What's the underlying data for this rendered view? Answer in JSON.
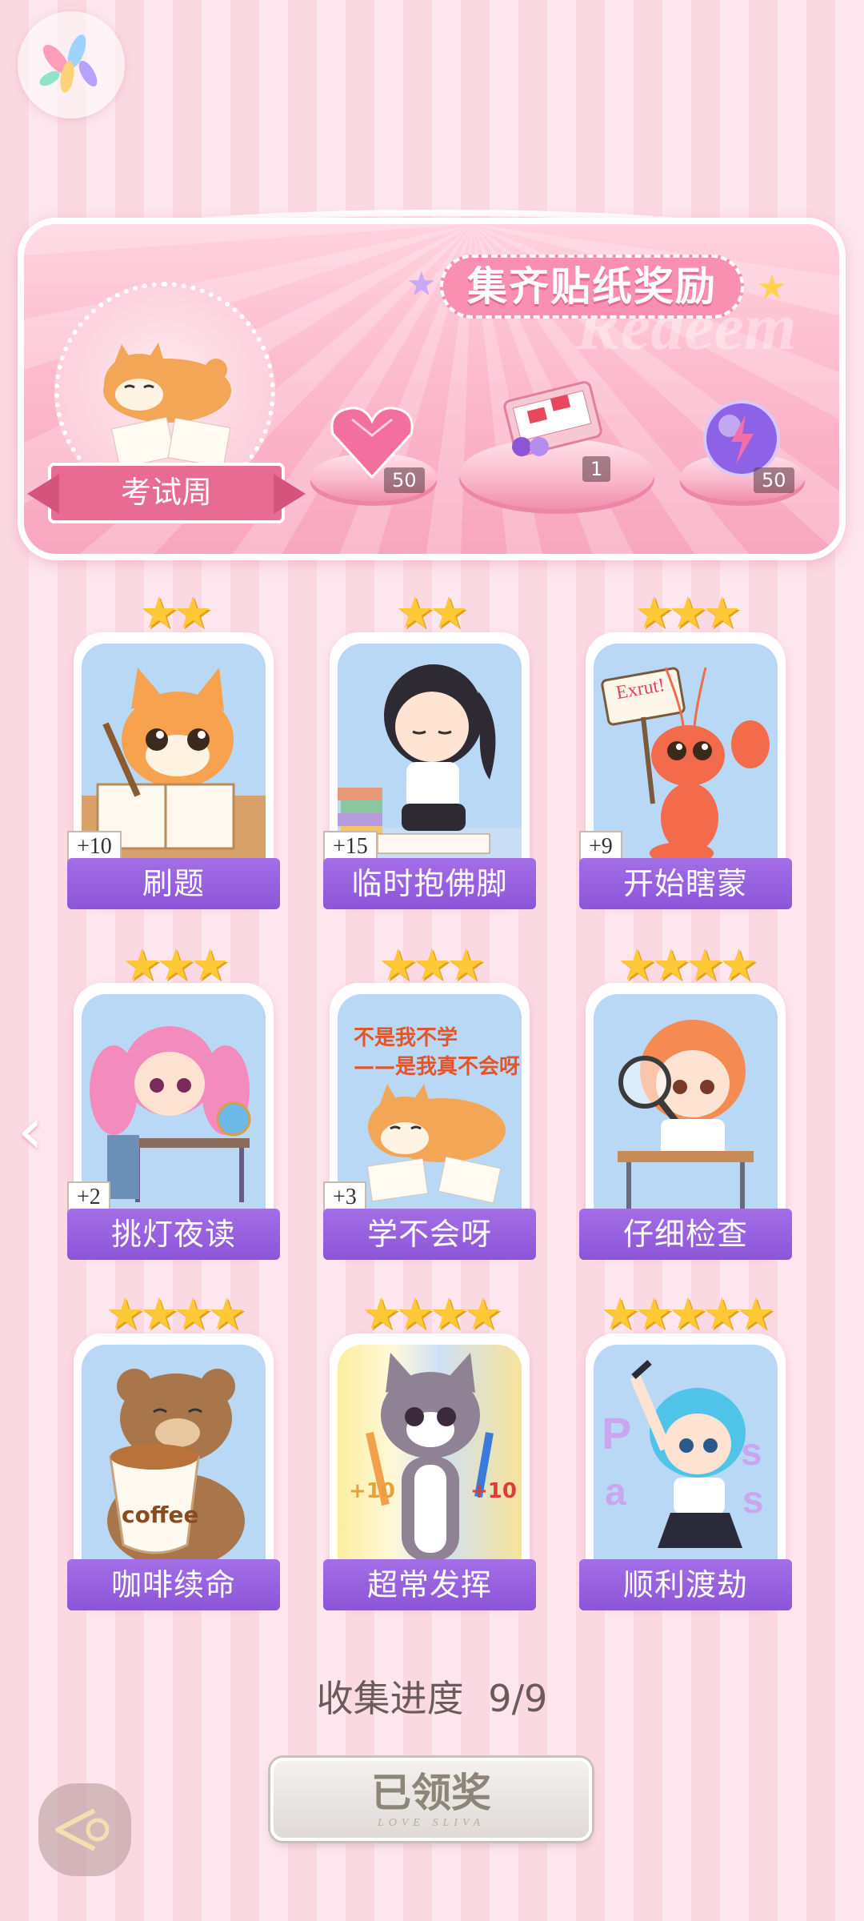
{
  "app_icon": "app-logo-icon",
  "banner": {
    "title": "集齐贴纸奖励",
    "watermark": "Redeem",
    "character_label": "考试周",
    "rewards": [
      {
        "icon": "pink-heart-gem-icon",
        "count": "50"
      },
      {
        "icon": "gift-box-icon",
        "count": "1"
      },
      {
        "icon": "lightning-orb-icon",
        "count": "50"
      }
    ]
  },
  "cards": [
    {
      "label": "刷题",
      "stars": "★★",
      "bonus": "+10"
    },
    {
      "label": "临时抱佛脚",
      "stars": "★★",
      "bonus": "+15"
    },
    {
      "label": "开始瞎蒙",
      "stars": "★★★",
      "bonus": "+9"
    },
    {
      "label": "挑灯夜读",
      "stars": "★★★",
      "bonus": "+2"
    },
    {
      "label": "学不会呀",
      "stars": "★★★",
      "bonus": "+3"
    },
    {
      "label": "仔细检查",
      "stars": "★★★★",
      "bonus": ""
    },
    {
      "label": "咖啡续命",
      "stars": "★★★★",
      "bonus": ""
    },
    {
      "label": "超常发挥",
      "stars": "★★★★",
      "bonus": ""
    },
    {
      "label": "顺利渡劫",
      "stars": "★★★★★",
      "bonus": ""
    }
  ],
  "art_text": {
    "sign": "Exrut!",
    "slogan_1": "不是我不学",
    "slogan_2": "——是我真不会呀",
    "coffee": "coffee",
    "plus10": "+10"
  },
  "progress": {
    "label": "收集进度",
    "value": "9/9"
  },
  "claim_button": {
    "label": "已领奖",
    "sub": "LOVE SLIVA"
  }
}
